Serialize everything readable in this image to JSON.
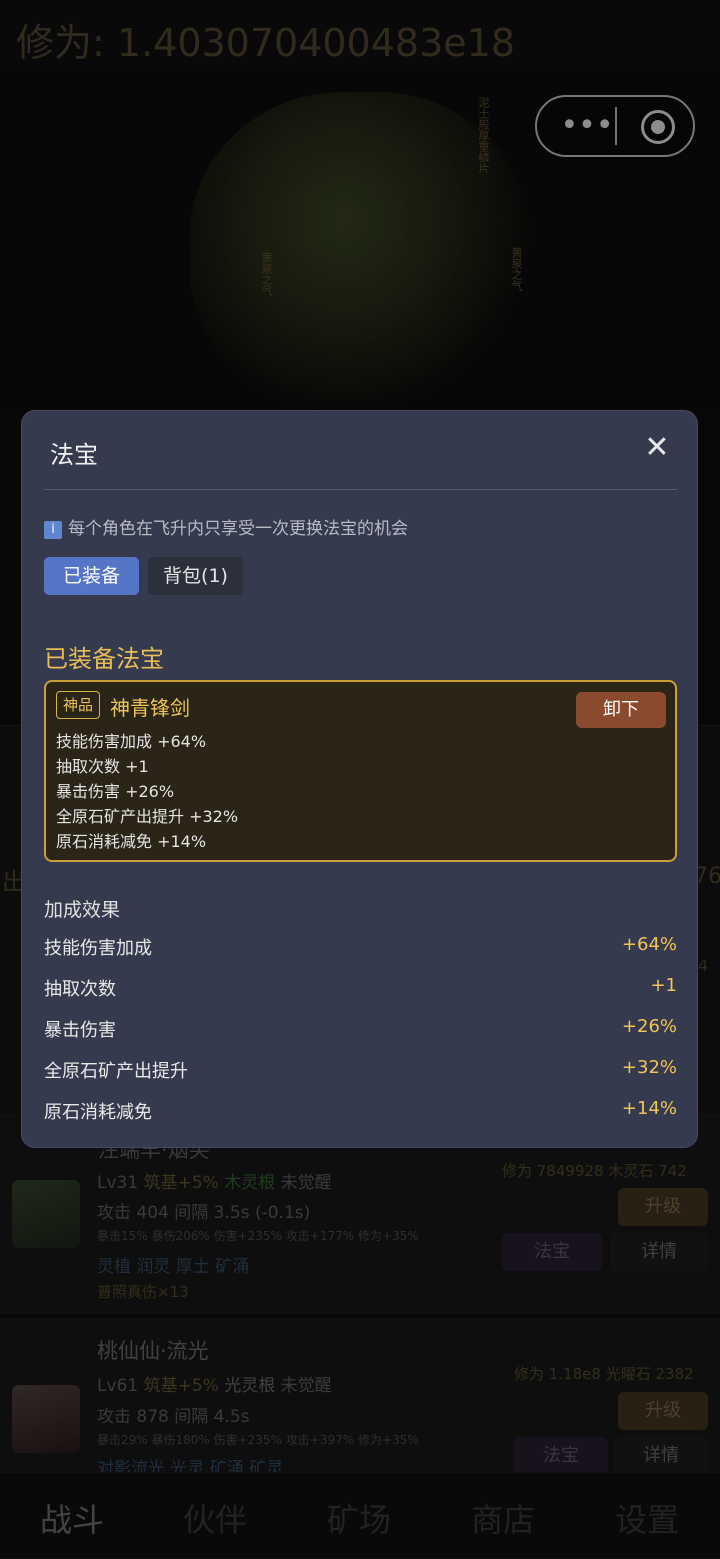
{
  "header": {
    "cultivation_text": "修为: 1.403070400483e18"
  },
  "capsule": {
    "more_glyph": "•••"
  },
  "hero": {
    "vertical_text_1": "泥土般厚重鳞片",
    "vertical_text_2": "黄泉之气",
    "vertical_text_3": "黄泉之气"
  },
  "background": {
    "left_label": "出",
    "right_num": "76",
    "right_num2": "4",
    "cards": [
      {
        "name": "注端早·烟笑",
        "level": "Lv31",
        "realm": "筑基+5%",
        "root": "木灵根",
        "awaken": "未觉醒",
        "attack": "攻击 404",
        "interval": "间隔 3.5s (-0.1s)",
        "stats": "暴击15% 暴伤206% 伤害+235% 攻击+177% 修为+35%",
        "skills": [
          "灵植",
          "润灵",
          "厚土",
          "矿涌"
        ],
        "extra": "普照真伤×13",
        "cultivation": "修为 7849928",
        "stone": "木灵石 742",
        "upgrade": "升级",
        "fabao": "法宝",
        "detail": "详情"
      },
      {
        "name": "桃仙仙·流光",
        "level": "Lv61",
        "realm": "筑基+5%",
        "root": "光灵根",
        "awaken": "未觉醒",
        "attack": "攻击 878",
        "interval": "间隔 4.5s",
        "stats": "暴击29% 暴伤180% 伤害+235% 攻击+397% 修为+35%",
        "skills": [
          "对影流光",
          "光灵",
          "矿涌",
          "矿灵"
        ],
        "cultivation": "修为 1.18e8",
        "stone": "光曜石 2382",
        "upgrade": "升级",
        "fabao": "法宝",
        "detail": "详情"
      }
    ]
  },
  "tabbar": {
    "items": [
      "战斗",
      "伙伴",
      "矿场",
      "商店",
      "设置"
    ]
  },
  "modal": {
    "title": "法宝",
    "close_glyph": "✕",
    "notice_icon": "i",
    "notice": "每个角色在飞升内只享受一次更换法宝的机会",
    "tab_equipped": "已装备",
    "tab_bag": "背包(1)",
    "section_title": "已装备法宝",
    "equip": {
      "grade": "神品",
      "name": "神青锋剑",
      "unequip": "卸下",
      "stats": [
        "技能伤害加成 +64%",
        "抽取次数 +1",
        "暴击伤害 +26%",
        "全原石矿产出提升 +32%",
        "原石消耗减免 +14%"
      ]
    },
    "bonus_title": "加成效果",
    "bonus": [
      {
        "label": "技能伤害加成",
        "value": "+64%"
      },
      {
        "label": "抽取次数",
        "value": "+1"
      },
      {
        "label": "暴击伤害",
        "value": "+26%"
      },
      {
        "label": "全原石矿产出提升",
        "value": "+32%"
      },
      {
        "label": "原石消耗减免",
        "value": "+14%"
      }
    ]
  }
}
